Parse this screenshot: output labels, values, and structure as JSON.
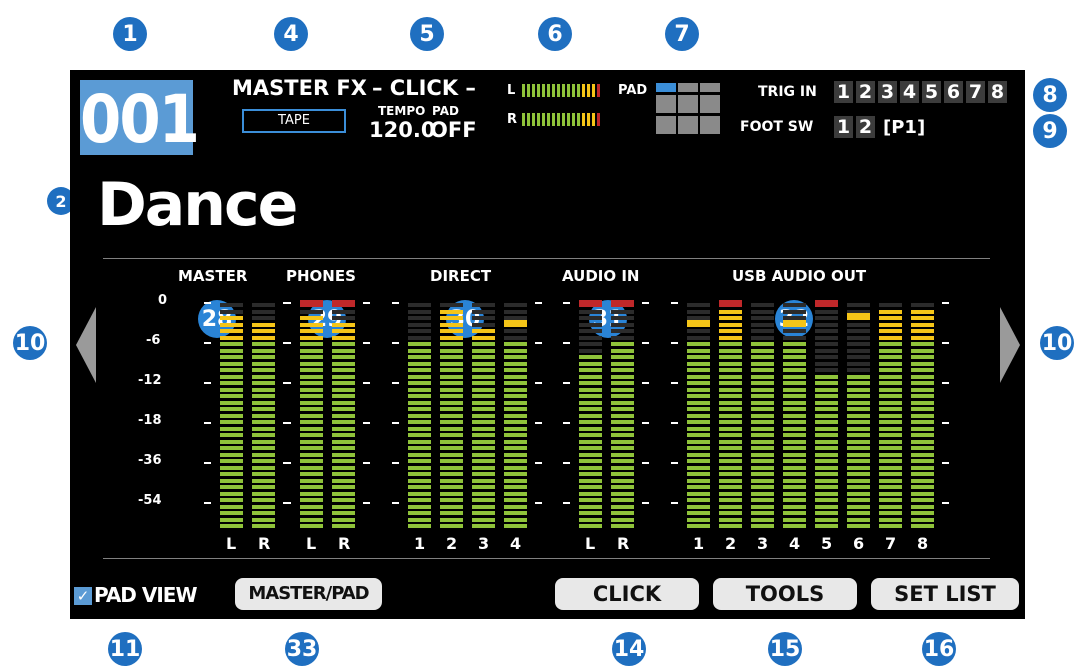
{
  "callouts": {
    "c1": "1",
    "c2": "2",
    "c4": "4",
    "c5": "5",
    "c6": "6",
    "c7": "7",
    "c8": "8",
    "c9": "9",
    "c10": "10",
    "c11": "11",
    "c14": "14",
    "c15": "15",
    "c16": "16",
    "c28": "28",
    "c29": "29",
    "c30": "30",
    "c31": "31",
    "c32": "32",
    "c33": "33"
  },
  "header": {
    "patch_number": "001",
    "master_fx_label": "MASTER FX",
    "master_fx_value": "TAPE",
    "click_label": "– CLICK –",
    "tempo_label": "TEMPO",
    "pad_label": "PAD",
    "tempo_value": "120.0",
    "pad_value": "OFF",
    "level_l": "L",
    "level_r": "R",
    "pad_indicator_label": "PAD",
    "trig_in_label": "TRIG IN",
    "trig_in_numbers": [
      "1",
      "2",
      "3",
      "4",
      "5",
      "6",
      "7",
      "8"
    ],
    "foot_sw_label": "FOOT SW",
    "foot_sw_numbers": [
      "1",
      "2"
    ],
    "foot_sw_page": "[P1]"
  },
  "patch_name": "Dance",
  "meters": {
    "scale": [
      "0",
      "-6",
      "-12",
      "-18",
      "-36",
      "-54"
    ],
    "groups": [
      {
        "label": "MASTER",
        "channels": [
          "L",
          "R"
        ]
      },
      {
        "label": "PHONES",
        "channels": [
          "L",
          "R"
        ]
      },
      {
        "label": "DIRECT",
        "channels": [
          "1",
          "2",
          "3",
          "4"
        ]
      },
      {
        "label": "AUDIO IN",
        "channels": [
          "L",
          "R"
        ]
      },
      {
        "label": "USB AUDIO OUT",
        "channels": [
          "1",
          "2",
          "3",
          "4",
          "5",
          "6",
          "7",
          "8"
        ]
      }
    ],
    "levels_db": {
      "master": [
        -2,
        -3
      ],
      "phones": [
        -2,
        -3
      ],
      "direct": [
        -6,
        -1,
        -4,
        -6
      ],
      "audio_in": [
        -7,
        -6
      ],
      "usb_audio_out": [
        -6,
        -1,
        -6,
        -6,
        -10,
        -10,
        -1,
        -1
      ]
    },
    "peak_holds_db": {
      "master": [
        null,
        null
      ],
      "phones": [
        0,
        0
      ],
      "direct": [
        null,
        null,
        null,
        -3
      ],
      "audio_in": [
        0,
        0
      ],
      "usb_audio_out": [
        -3,
        0,
        null,
        -3,
        0,
        -2,
        null,
        null
      ]
    }
  },
  "footer": {
    "pad_view_label": "PAD VIEW",
    "pad_view_checked": true,
    "master_pad_button": "MASTER/PAD",
    "click_button": "CLICK",
    "tools_button": "TOOLS",
    "set_list_button": "SET LIST"
  },
  "colors": {
    "screen_bg": "#000000",
    "patch_number_bg": "#5b9bd5",
    "callout": "#1f6fc0",
    "meter_green": "#8fc33a",
    "meter_yellow": "#f5c518",
    "meter_red": "#c0282a"
  }
}
